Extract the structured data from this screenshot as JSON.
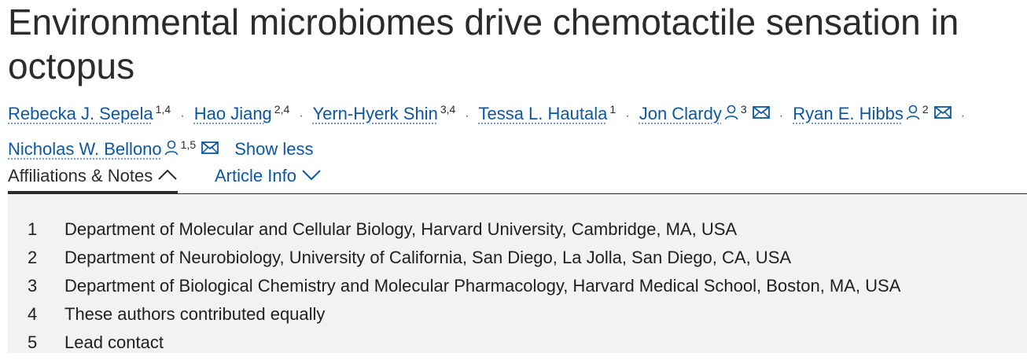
{
  "title": "Environmental microbiomes drive chemotactile sensation in octopus",
  "authors": [
    {
      "name": "Rebecka J. Sepela",
      "affil": "1,4",
      "person_icon": false,
      "mail_icon": false
    },
    {
      "name": "Hao Jiang",
      "affil": "2,4",
      "person_icon": false,
      "mail_icon": false
    },
    {
      "name": "Yern-Hyerk Shin",
      "affil": "3,4",
      "person_icon": false,
      "mail_icon": false
    },
    {
      "name": "Tessa L. Hautala",
      "affil": "1",
      "person_icon": false,
      "mail_icon": false
    },
    {
      "name": "Jon Clardy",
      "affil": "3",
      "person_icon": true,
      "mail_icon": true
    },
    {
      "name": "Ryan E. Hibbs",
      "affil": "2",
      "person_icon": true,
      "mail_icon": true
    },
    {
      "name": "Nicholas W. Bellono",
      "affil": "1,5",
      "person_icon": true,
      "mail_icon": true
    }
  ],
  "separator": "·",
  "show_less": "Show less",
  "tabs": {
    "affiliations": "Affiliations & Notes",
    "article_info": "Article Info"
  },
  "affiliations": [
    {
      "num": "1",
      "text": "Department of Molecular and Cellular Biology, Harvard University, Cambridge, MA, USA"
    },
    {
      "num": "2",
      "text": "Department of Neurobiology, University of California, San Diego, La Jolla, San Diego, CA, USA"
    },
    {
      "num": "3",
      "text": "Department of Biological Chemistry and Molecular Pharmacology, Harvard Medical School, Boston, MA, USA"
    },
    {
      "num": "4",
      "text": "These authors contributed equally"
    },
    {
      "num": "5",
      "text": "Lead contact"
    }
  ],
  "icons": {
    "person": "person-icon",
    "mail": "mail-icon",
    "chevron_up": "chevron-up-icon",
    "chevron_down": "chevron-down-icon"
  },
  "colors": {
    "link": "#0b57a4",
    "text": "#2b2b2b",
    "panel_bg": "#f2f2f2"
  }
}
